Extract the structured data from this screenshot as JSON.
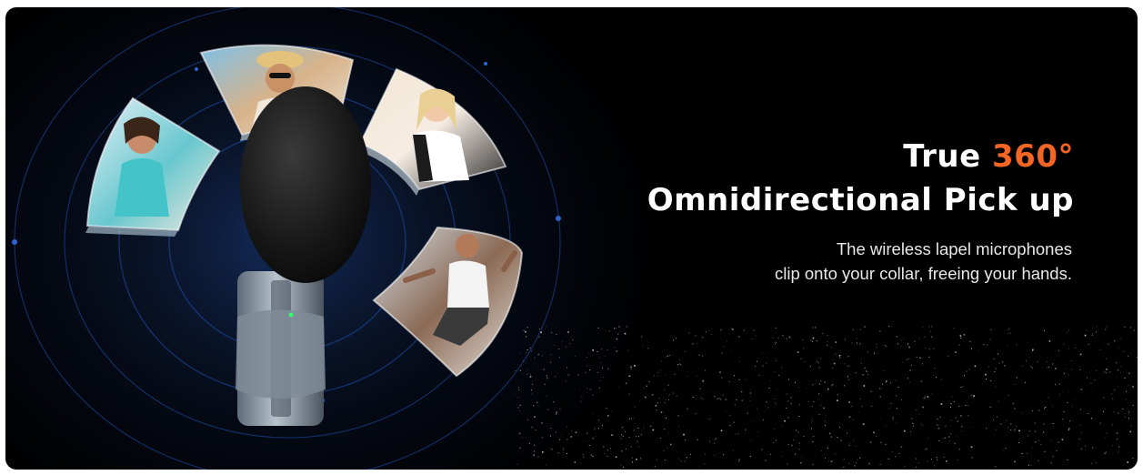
{
  "headline": {
    "prefix": "True ",
    "accent": "360°",
    "line2": "Omnidirectional Pick up",
    "accent_color": "#f26522"
  },
  "subtitle": {
    "line1": "The wireless lapel microphones",
    "line2": "clip onto your collar, freeing your hands."
  },
  "photos": [
    {
      "name": "woman-at-desk-photo"
    },
    {
      "name": "man-selfie-beach-photo"
    },
    {
      "name": "woman-makeup-photo"
    },
    {
      "name": "man-gym-workout-photo"
    }
  ],
  "colors": {
    "background": "#000000",
    "ring": "#1e4fa8",
    "led": "#36ff7a"
  }
}
